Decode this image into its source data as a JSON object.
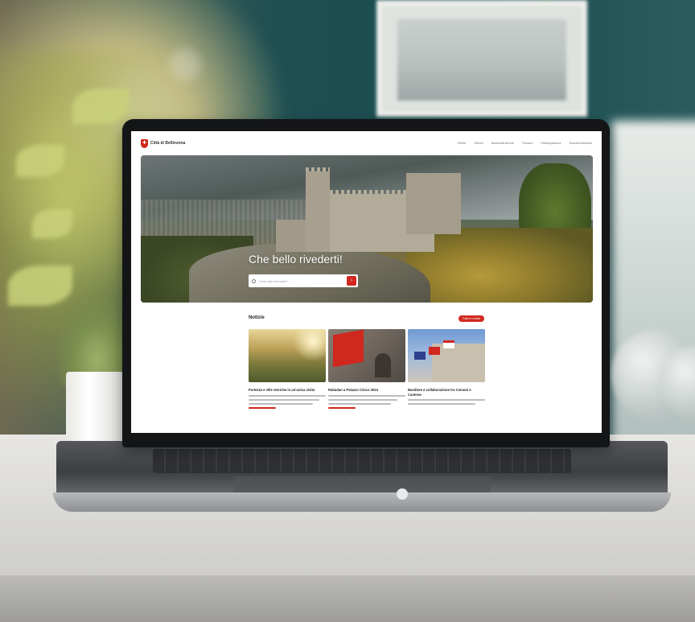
{
  "site": {
    "logo_text": "Città di Bellinzona",
    "nav": [
      "Vivere",
      "Servizi",
      "Amministrazione",
      "Turismo",
      "Partecipazione",
      "Documentazione"
    ]
  },
  "hero": {
    "title": "Che bello rivederti!",
    "search_placeholder": "Cosa stai cercando?"
  },
  "news": {
    "heading": "Notizie",
    "more_label": "Tutte le notizie",
    "cards": [
      {
        "title": "Fortezza e ville storiche in un'unica visita"
      },
      {
        "title": "Rabadan a Palazzo Civico 2024"
      },
      {
        "title": "Bandiere e collaborazione tra Comuni e Cantone"
      }
    ]
  },
  "colors": {
    "brand_red": "#d0281f",
    "wall_teal": "#1b4d50",
    "desk": "#e7e6e2"
  }
}
